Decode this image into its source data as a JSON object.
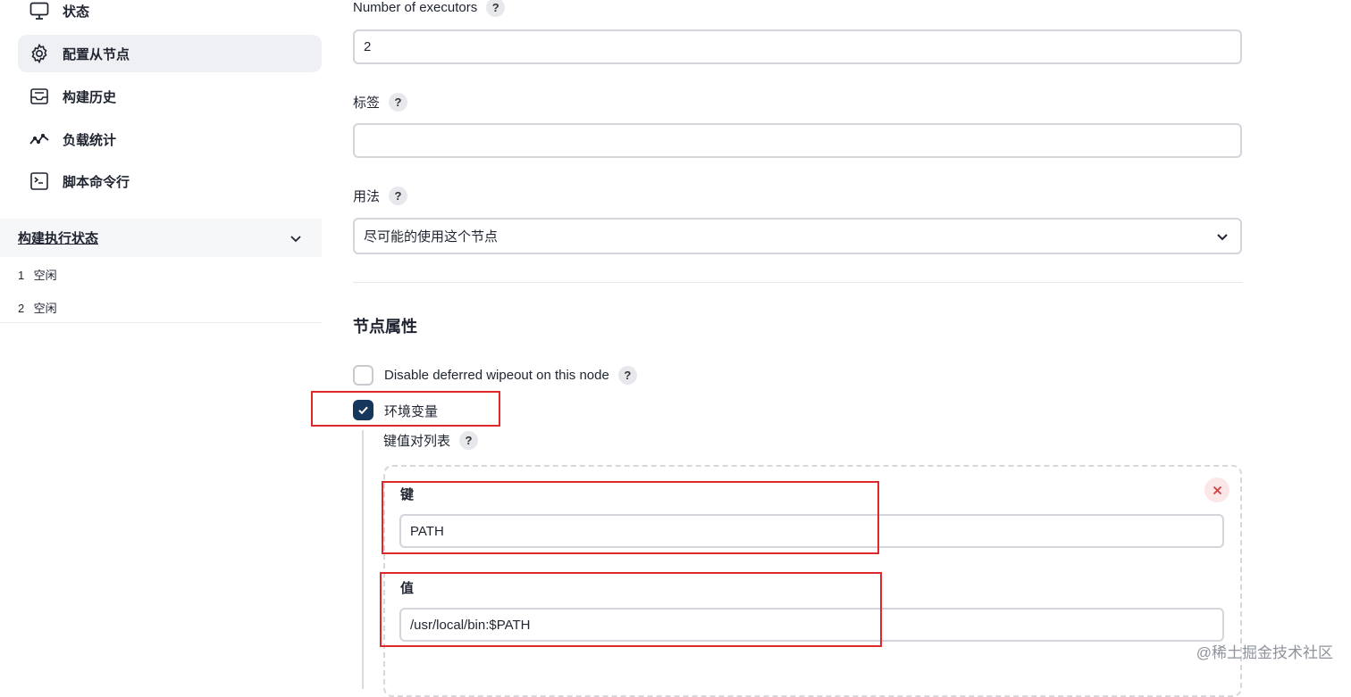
{
  "sidebar": {
    "items": [
      {
        "label": "状态",
        "icon": "monitor-icon",
        "active": false
      },
      {
        "label": "配置从节点",
        "icon": "gear-icon",
        "active": true
      },
      {
        "label": "构建历史",
        "icon": "inbox-icon",
        "active": false
      },
      {
        "label": "负载统计",
        "icon": "trend-line-icon",
        "active": false
      },
      {
        "label": "脚本命令行",
        "icon": "terminal-icon",
        "active": false
      }
    ],
    "executor_status": {
      "title": "构建执行状态",
      "executors": [
        {
          "number": "1",
          "state": "空闲"
        },
        {
          "number": "2",
          "state": "空闲"
        }
      ]
    }
  },
  "form": {
    "executors": {
      "label": "Number of executors",
      "value": "2",
      "help": "?"
    },
    "labels": {
      "label": "标签",
      "value": "",
      "help": "?"
    },
    "usage": {
      "label": "用法",
      "selected": "尽可能的使用这个节点",
      "help": "?"
    },
    "node_properties": {
      "title": "节点属性",
      "disable_wipeout": {
        "label": "Disable deferred wipeout on this node",
        "checked": false,
        "help": "?"
      },
      "env_vars": {
        "label": "环境变量",
        "checked": true,
        "list_label": "键值对列表",
        "help": "?",
        "entry": {
          "key_label": "键",
          "key_value": "PATH",
          "value_label": "值",
          "value_value": "/usr/local/bin:$PATH"
        }
      }
    }
  },
  "watermark": "@稀土掘金技术社区",
  "colors": {
    "accent": "#16365c",
    "highlight": "#e0272a",
    "active_bg": "#eef0f4"
  }
}
